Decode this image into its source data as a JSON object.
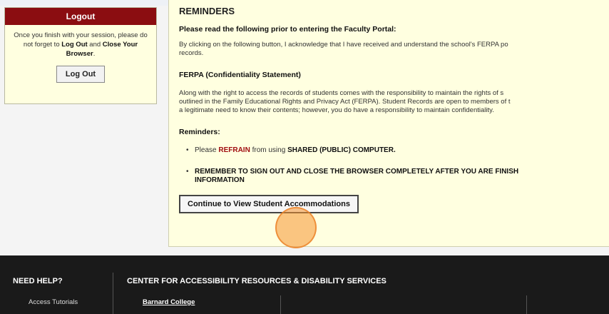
{
  "sidebar": {
    "logout_title": "Logout",
    "message_pre": "Once you finish with your session, please do not forget to ",
    "message_logout": "Log Out",
    "message_mid": " and ",
    "message_close": "Close Your Browser",
    "message_end": ".",
    "logout_button": "Log Out"
  },
  "reminders": {
    "title": "REMINDERS",
    "intro_heading": "Please read the following prior to entering the Faculty Portal:",
    "intro_line1": "By clicking on the following button, I acknowledge that I have received and understand the school's FERPA po",
    "intro_line2": "records.",
    "ferpa_heading": "FERPA (Confidentiality Statement)",
    "ferpa_line1": "Along with the right to access the records of students comes with the responsibility to maintain the rights of s",
    "ferpa_line2": "outlined in the Family Educational Rights and Privacy Act (FERPA). Student Records are open to members of t",
    "ferpa_line3": "a legitimate need to know their contents; however, you do have a responsibility to maintain confidentiality.",
    "reminders_heading": "Reminders:",
    "bullet1_pre": "Please ",
    "bullet1_refrain": "REFRAIN",
    "bullet1_mid": " from using ",
    "bullet1_shared": "SHARED (PUBLIC) COMPUTER.",
    "bullet2_line1": "REMEMBER TO SIGN OUT AND CLOSE THE BROWSER COMPLETELY AFTER YOU ARE FINISH",
    "bullet2_line2": "INFORMATION",
    "continue_button": "Continue to View Student Accommodations"
  },
  "footer": {
    "need_help": "NEED HELP?",
    "center_title": "CENTER FOR ACCESSIBILITY RESOURCES & DISABILITY SERVICES",
    "access_tutorials": "Access Tutorials",
    "barnard": "Barnard College"
  },
  "colors": {
    "panel_bg": "#ffffe0",
    "logout_header": "#8b0d11",
    "refrain_red": "#a00d10",
    "footer_bg": "#1a1a1a",
    "click_marker": "#f59632"
  }
}
